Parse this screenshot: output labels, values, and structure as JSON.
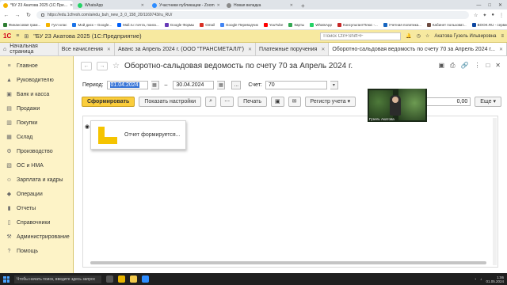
{
  "browser": {
    "tabs": [
      {
        "label": "*БУ 23 Акатова 2025 (1С:Пре...",
        "color": "#f5b400",
        "active": true
      },
      {
        "label": "WhatsApp",
        "color": "#25d366",
        "active": false
      },
      {
        "label": "Участники публикации - Zoom",
        "color": "#2d8cff",
        "active": false
      },
      {
        "label": "Новая вкладка",
        "color": "#8a8a8a",
        "active": false
      }
    ],
    "new_tab": "+",
    "window_controls": [
      "—",
      "□",
      "✕"
    ],
    "url": "https://edu.1cfresh.com/a/edu_buh_new_3_0_158_20/1169743/ru_RU/",
    "bookmarks": [
      {
        "label": "Финансовая грам...",
        "color": "#2e7d32"
      },
      {
        "label": "Гугл клас",
        "color": "#f4b400"
      },
      {
        "label": "Мой диск – Google...",
        "color": "#1a73e8"
      },
      {
        "label": "Mail.ru: почта, поиск...",
        "color": "#005ff9"
      },
      {
        "label": "Google Формы",
        "color": "#673ab7"
      },
      {
        "label": "Gmail",
        "color": "#d93025"
      },
      {
        "label": "Google Переводчик",
        "color": "#4285f4"
      },
      {
        "label": "YouTube",
        "color": "#ff0000"
      },
      {
        "label": "Карты",
        "color": "#34a853"
      },
      {
        "label": "WhatsApp",
        "color": "#25d366"
      },
      {
        "label": "КонсультантПлюс -...",
        "color": "#c62828"
      },
      {
        "label": "Учетная политика...",
        "color": "#1565c0"
      },
      {
        "label": "Кабинет пользоват...",
        "color": "#6d4c41"
      },
      {
        "label": "BOOK.RU - сервис...",
        "color": "#0d47a1"
      },
      {
        "label": "Все закладки",
        "color": "#f9a825"
      }
    ]
  },
  "app": {
    "logo": "1С",
    "title": "\"БУ 23 Акатова 2025 (1С:Предприятие)",
    "search_placeholder": "Поиск Ctrl+Shift+F",
    "user": "Акатова Гузель Ильвировна"
  },
  "open_tabs": {
    "home": "Начальная страница",
    "tabs": [
      {
        "label": "Все начисления",
        "active": false
      },
      {
        "label": "Аванс за Апрель 2024 г. (ООО \"ТРАНСМЕТАЛЛ\")",
        "active": false
      },
      {
        "label": "Платежные поручения",
        "active": false
      },
      {
        "label": "Оборотно-сальдовая ведомость по счету 70 за Апрель 2024 г...",
        "active": true
      }
    ]
  },
  "sidebar": {
    "items": [
      {
        "label": "Главное",
        "icon": "≡"
      },
      {
        "label": "Руководителю",
        "icon": "▲"
      },
      {
        "label": "Банк и касса",
        "icon": "▣"
      },
      {
        "label": "Продажи",
        "icon": "▤"
      },
      {
        "label": "Покупки",
        "icon": "▥"
      },
      {
        "label": "Склад",
        "icon": "▦"
      },
      {
        "label": "Производство",
        "icon": "⚙"
      },
      {
        "label": "ОС и НМА",
        "icon": "▧"
      },
      {
        "label": "Зарплата и кадры",
        "icon": "☺"
      },
      {
        "label": "Операции",
        "icon": "◆"
      },
      {
        "label": "Отчеты",
        "icon": "▮"
      },
      {
        "label": "Справочники",
        "icon": "▯"
      },
      {
        "label": "Администрирование",
        "icon": "⚒"
      },
      {
        "label": "Помощь",
        "icon": "?"
      }
    ]
  },
  "form": {
    "title": "Оборотно-сальдовая ведомость по счету 70 за Апрель 2024 г.",
    "period_label": "Период:",
    "date_from": "01.04.2024",
    "date_sep": "–",
    "date_to": "30.04.2024",
    "ellipsis": "...",
    "account_label": "Счет:",
    "account_value": "70",
    "buttons": {
      "generate": "Сформировать",
      "settings": "Показать настройки",
      "print": "Печать",
      "register": "Регистр учета",
      "more": "Еще"
    },
    "sum_value": "0,00",
    "progress_text": "Отчет формируется..."
  },
  "webcam": {
    "caption": "Гузель Акатова"
  },
  "taskbar": {
    "search_placeholder": "Чтобы начать поиск, введите здесь запрос",
    "time": "1:06",
    "date": "01.05.2024"
  }
}
